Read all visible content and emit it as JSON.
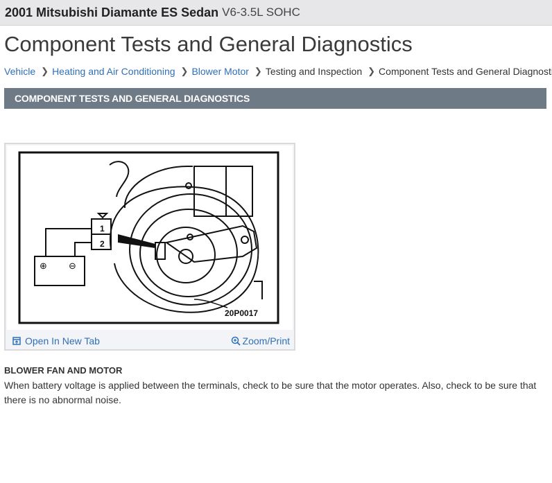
{
  "header": {
    "vehicle": "2001 Mitsubishi Diamante ES Sedan",
    "engine": "V6-3.5L SOHC"
  },
  "page_title": "Component Tests and General Diagnostics",
  "breadcrumb": [
    {
      "label": "Vehicle",
      "link": true
    },
    {
      "label": "Heating and Air Conditioning",
      "link": true
    },
    {
      "label": "Blower Motor",
      "link": true
    },
    {
      "label": "Testing and Inspection",
      "link": false
    },
    {
      "label": "Component Tests and General Diagnostics",
      "link": false
    }
  ],
  "section_header": "COMPONENT TESTS AND GENERAL DIAGNOSTICS",
  "figure": {
    "code": "20P0017",
    "terminal_1": "1",
    "terminal_2": "2",
    "battery_positive": "⊕",
    "battery_negative": "⊖",
    "open_label": "Open In New Tab",
    "zoom_label": "Zoom/Print",
    "link_color": "#2f6fb6"
  },
  "content": {
    "heading": "BLOWER FAN AND MOTOR",
    "text": "When battery voltage is applied between the terminals, check to be sure that the motor operates. Also, check to be sure that there is no abnormal noise."
  }
}
